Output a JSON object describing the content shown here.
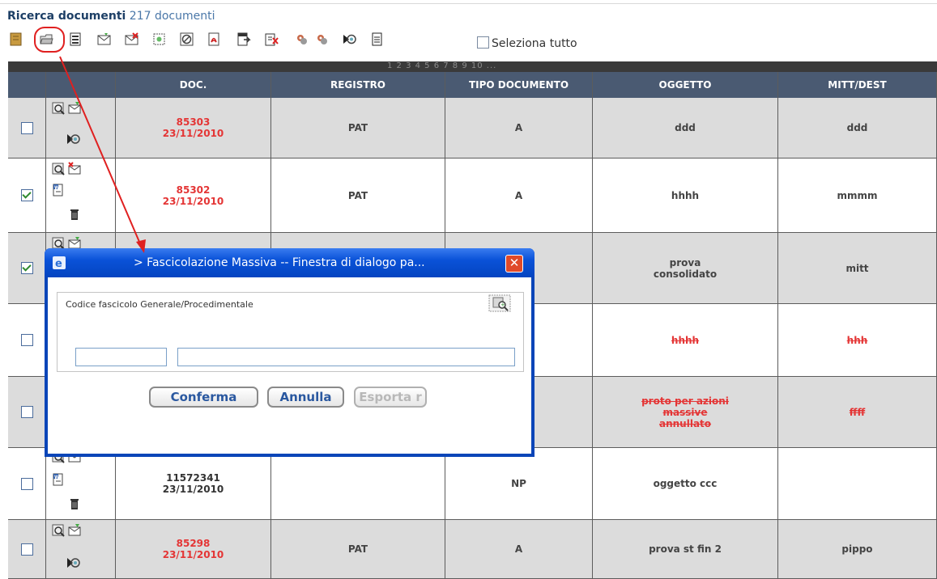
{
  "header": {
    "title": "Ricerca documenti",
    "count": "217 documenti"
  },
  "toolbar": {
    "icons": [
      "archive-icon",
      "folder-fascicolazione-icon",
      "document-list-icon",
      "mail-send-icon",
      "mail-delete-icon",
      "stamp-icon",
      "cancel-circle-icon",
      "pdf-icon",
      "export-icon",
      "delete-doc-icon",
      "tag-icon",
      "tag-icon",
      "transmit-icon",
      "report-icon"
    ],
    "select_all_label": "Seleziona tutto"
  },
  "pager": {
    "text": "1 2 3 4 5 6 7 8 9 10 ..."
  },
  "columns": [
    "",
    "",
    "DOC.",
    "REGISTRO",
    "TIPO DOCUMENTO",
    "OGGETTO",
    "MITT/DEST"
  ],
  "rows": [
    {
      "checked": false,
      "doc_num": "85303",
      "doc_date": "23/11/2010",
      "doc_color": "red",
      "registro": "PAT",
      "tipo": "A",
      "oggetto": "ddd",
      "mitt": "ddd",
      "annullato": false
    },
    {
      "checked": true,
      "doc_num": "85302",
      "doc_date": "23/11/2010",
      "doc_color": "red",
      "registro": "PAT",
      "tipo": "A",
      "oggetto": "hhhh",
      "mitt": "mmmm",
      "annullato": false
    },
    {
      "checked": true,
      "doc_num": "",
      "doc_date": "",
      "doc_color": "red",
      "registro": "",
      "tipo": "",
      "oggetto": "prova consolidato",
      "mitt": "mitt",
      "annullato": false
    },
    {
      "checked": false,
      "doc_num": "",
      "doc_date": "",
      "doc_color": "red",
      "registro": "",
      "tipo": "",
      "oggetto": "hhhh",
      "mitt": "hhh",
      "annullato": true
    },
    {
      "checked": false,
      "doc_num": "",
      "doc_date": "",
      "doc_color": "red",
      "registro": "",
      "tipo": "",
      "oggetto": "proto per azioni massive annullato",
      "mitt": "ffff",
      "annullato": true
    },
    {
      "checked": false,
      "doc_num": "11572341",
      "doc_date": "23/11/2010",
      "doc_color": "black",
      "registro": "",
      "tipo": "NP",
      "oggetto": "oggetto ccc",
      "mitt": "",
      "annullato": false
    },
    {
      "checked": false,
      "doc_num": "85298",
      "doc_date": "23/11/2010",
      "doc_color": "red",
      "registro": "PAT",
      "tipo": "A",
      "oggetto": "prova st fin 2",
      "mitt": "pippo",
      "annullato": false
    }
  ],
  "dialog": {
    "title": "> Fascicolazione Massiva -- Finestra di dialogo pa...",
    "fieldset_label": "Codice fascicolo Generale/Procedimentale",
    "code_value": "",
    "description_value": "",
    "buttons": {
      "confirm": "Conferma",
      "cancel": "Annulla",
      "export": "Esporta r"
    }
  },
  "colors": {
    "header_bg": "#4a5a72",
    "row_odd": "#dcdcdc",
    "row_even": "#ffffff",
    "doc_red": "#e43535",
    "dialog_blue": "#0a52d8",
    "annotation_red": "#e02020"
  }
}
